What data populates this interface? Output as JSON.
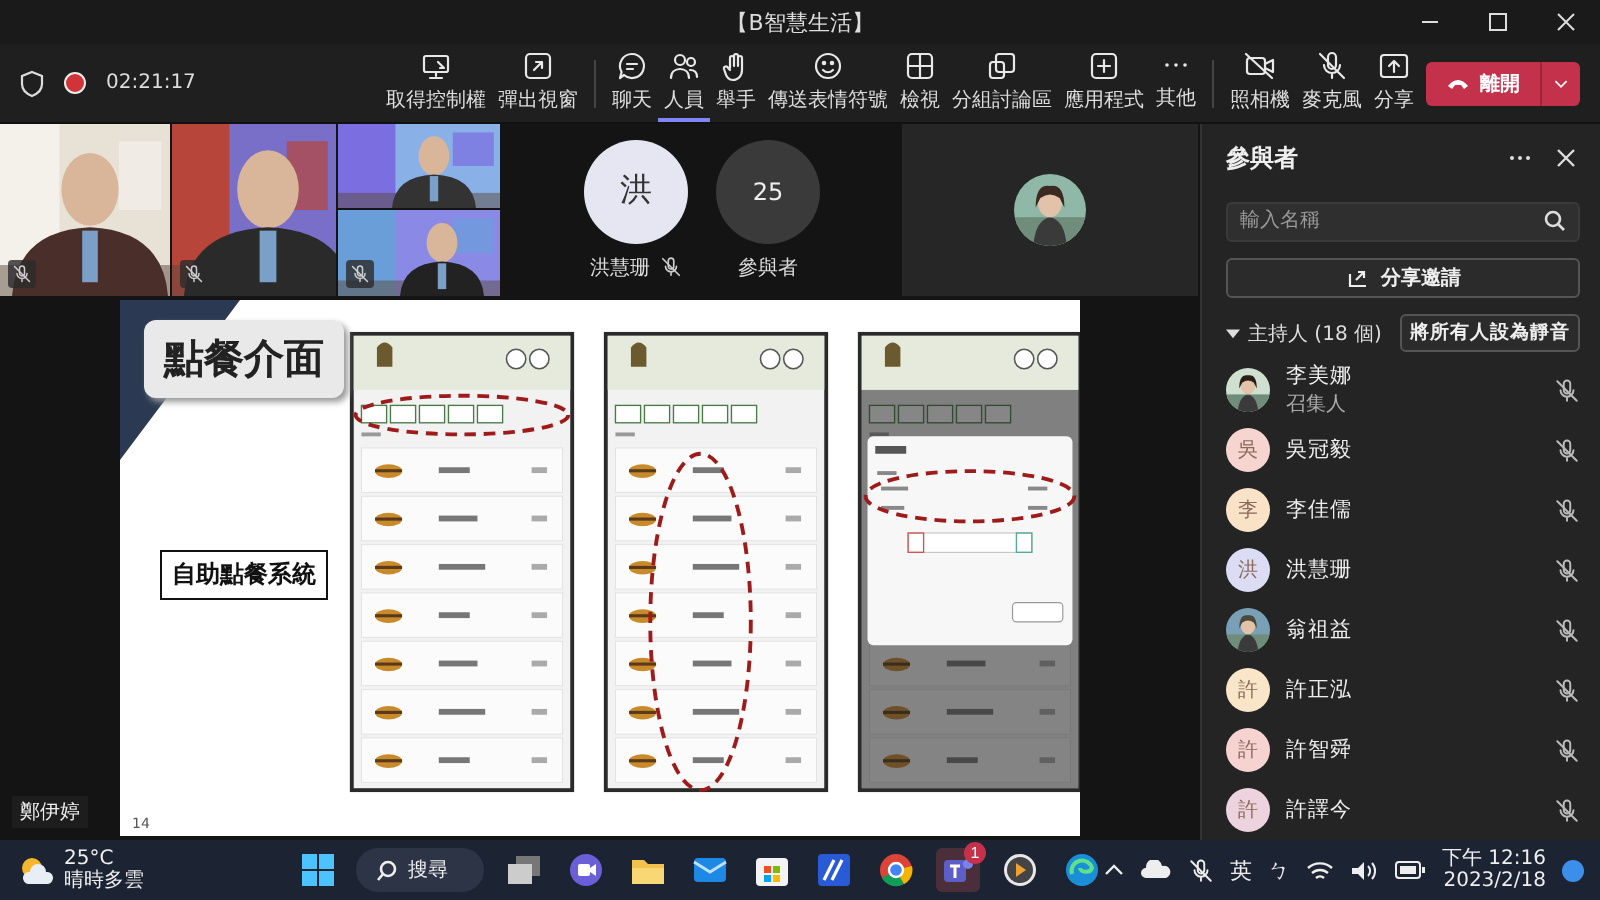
{
  "window": {
    "title": "【B智慧生活】"
  },
  "meeting_bar": {
    "timer": "02:21:17",
    "recording": true,
    "button_groups": [
      {
        "buttons": [
          {
            "label": "取得控制權",
            "selected": false
          },
          {
            "label": "彈出視窗",
            "selected": false
          }
        ]
      },
      {
        "buttons": [
          {
            "label": "聊天",
            "selected": false
          },
          {
            "label": "人員",
            "selected": true
          },
          {
            "label": "舉手",
            "selected": false
          },
          {
            "label": "傳送表情符號",
            "selected": false
          },
          {
            "label": "檢視",
            "selected": false
          },
          {
            "label": "分組討論區",
            "selected": false
          },
          {
            "label": "應用程式",
            "selected": false
          },
          {
            "label": "其他",
            "selected": false
          }
        ]
      },
      {
        "buttons": [
          {
            "label": "照相機",
            "selected": false
          },
          {
            "label": "麥克風",
            "selected": false
          },
          {
            "label": "分享",
            "selected": false
          }
        ]
      }
    ],
    "leave_button": "離開"
  },
  "stage": {
    "spotlight": {
      "initial": "洪",
      "name": "洪慧珊",
      "muted": true
    },
    "overflow": {
      "count": "25",
      "label": "參與者"
    },
    "presenter_name": "鄭伊婷",
    "slide": {
      "title": "點餐介面",
      "caption": "自助點餐系統",
      "page": "14"
    }
  },
  "participants_panel": {
    "title": "參與者",
    "search": {
      "placeholder": "輸入名稱"
    },
    "invite_button": "分享邀請",
    "section": {
      "label": "主持人 (18 個)",
      "expanded": true,
      "action": "將所有人設為靜音"
    },
    "people": [
      {
        "name": "李美娜",
        "role": "召集人",
        "muted": true
      },
      {
        "name": "吳冠毅",
        "initial": "吳",
        "kind": "initial",
        "color": "#f6d5d0",
        "muted": true
      },
      {
        "name": "李佳儒",
        "initial": "李",
        "kind": "initial",
        "color": "#f9e2c6",
        "muted": true
      },
      {
        "name": "洪慧珊",
        "initial": "洪",
        "kind": "initial",
        "color": "#dcdcf4",
        "muted": true
      },
      {
        "name": "翁祖益",
        "muted": true
      },
      {
        "name": "許正泓",
        "initial": "許",
        "kind": "initial",
        "color": "#f9e6c8",
        "muted": true
      },
      {
        "name": "許智舜",
        "initial": "許",
        "kind": "initial",
        "color": "#f6d3d0",
        "muted": true
      },
      {
        "name": "許譯今",
        "initial": "許",
        "kind": "initial",
        "color": "#ecd3de",
        "muted": true
      }
    ]
  },
  "taskbar": {
    "weather": {
      "temperature": "25°C",
      "condition": "晴時多雲"
    },
    "search_label": "搜尋",
    "teams_badge": "1",
    "tray": {
      "language": "英",
      "input_mode": "ㄅ"
    },
    "clock": {
      "time": "下午 12:16",
      "date": "2023/2/18"
    }
  }
}
